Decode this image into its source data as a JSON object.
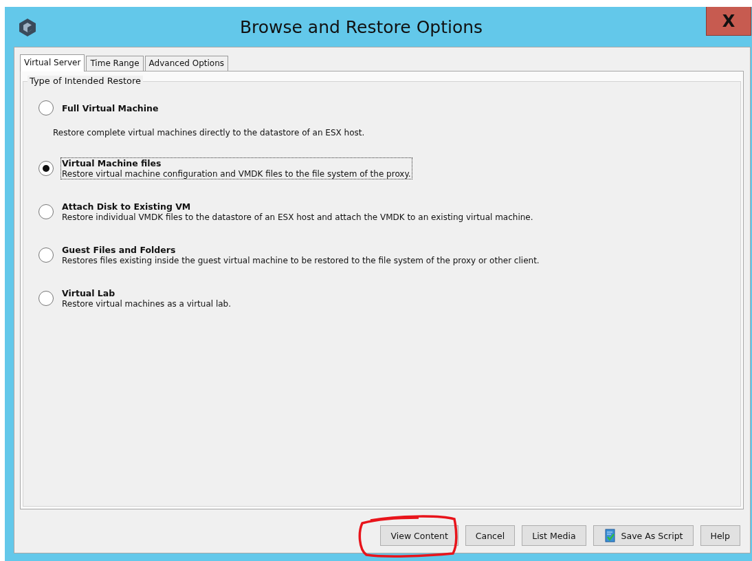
{
  "window": {
    "title": "Browse and Restore Options",
    "close": "X"
  },
  "tabs": [
    {
      "label": "Virtual Server",
      "selected": true
    },
    {
      "label": "Time Range",
      "selected": false
    },
    {
      "label": "Advanced Options",
      "selected": false
    }
  ],
  "group": {
    "title": "Type of Intended Restore"
  },
  "options": [
    {
      "kind": "stacked",
      "label": "Full Virtual Machine",
      "description": "Restore complete virtual machines directly to the datastore of an ESX host.",
      "selected": false,
      "focused": false
    },
    {
      "kind": "inline",
      "label": "Virtual Machine files",
      "description": "Restore virtual machine configuration and VMDK files to the file system of the proxy.",
      "selected": true,
      "focused": true
    },
    {
      "kind": "inline",
      "label": "Attach Disk to Existing VM",
      "description": "Restore individual VMDK files to the datastore of an ESX host and attach the VMDK to an existing virtual machine.",
      "selected": false,
      "focused": false
    },
    {
      "kind": "inline",
      "label": "Guest Files and Folders",
      "description": "Restores files existing inside the guest virtual machine to be restored to the file system of the proxy or other client.",
      "selected": false,
      "focused": false
    },
    {
      "kind": "inline",
      "label": "Virtual Lab",
      "description": "Restore virtual machines as a virtual lab.",
      "selected": false,
      "focused": false
    }
  ],
  "buttons": [
    {
      "kind": "plain",
      "label": "View Content",
      "highlighted": true
    },
    {
      "kind": "plain",
      "label": "Cancel",
      "highlighted": false
    },
    {
      "kind": "plain",
      "label": "List Media",
      "highlighted": false
    },
    {
      "kind": "script",
      "label": "Save As Script",
      "highlighted": false
    },
    {
      "kind": "plain",
      "label": "Help",
      "highlighted": false
    }
  ]
}
